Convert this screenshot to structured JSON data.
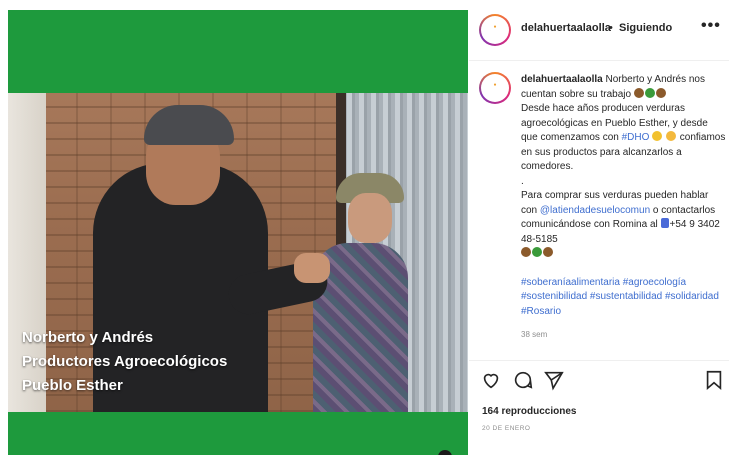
{
  "post": {
    "username": "delahuertaalaolla",
    "separator": "•",
    "follow_status": "Siguiendo",
    "more": "•••",
    "avatar_logo_text": "DE LA HUERTA A LA OLLA"
  },
  "video": {
    "caption_lines": [
      "Norberto y Andrés",
      "Productores Agroecológicos",
      "Pueblo Esther"
    ]
  },
  "comment": {
    "username": "delahuertaalaolla",
    "line1": "Norberto y Andrés nos cuentan sobre su trabajo",
    "line2": "Desde hace años producen verduras agroecológicas en Pueblo Esther, y desde que comenzamos con",
    "hashtag_dho": "#DHO",
    "line3": "confiamos en sus productos para alcanzarlos a comedores.",
    "dot": ".",
    "line4": "Para comprar sus verduras pueden hablar con",
    "mention": "@latiendadesuelocomun",
    "line5": "o contactarlos comunicándose con Romina al",
    "phone": "+54 9 3402 48-5185",
    "hashtags": "#soberaníaalimentaria #agroecología #sostenibilidad #sustentabilidad #solidaridad #Rosario",
    "time": "38 sem"
  },
  "actions": {
    "like_icon": "heart-icon",
    "comment_icon": "comment-icon",
    "share_icon": "send-icon",
    "save_icon": "bookmark-icon",
    "views": "164 reproducciones",
    "date": "20 DE ENERO"
  },
  "colors": {
    "media_bg": "#1e9a3d",
    "link": "#3f6ecf",
    "muted": "#8e8e8e"
  }
}
